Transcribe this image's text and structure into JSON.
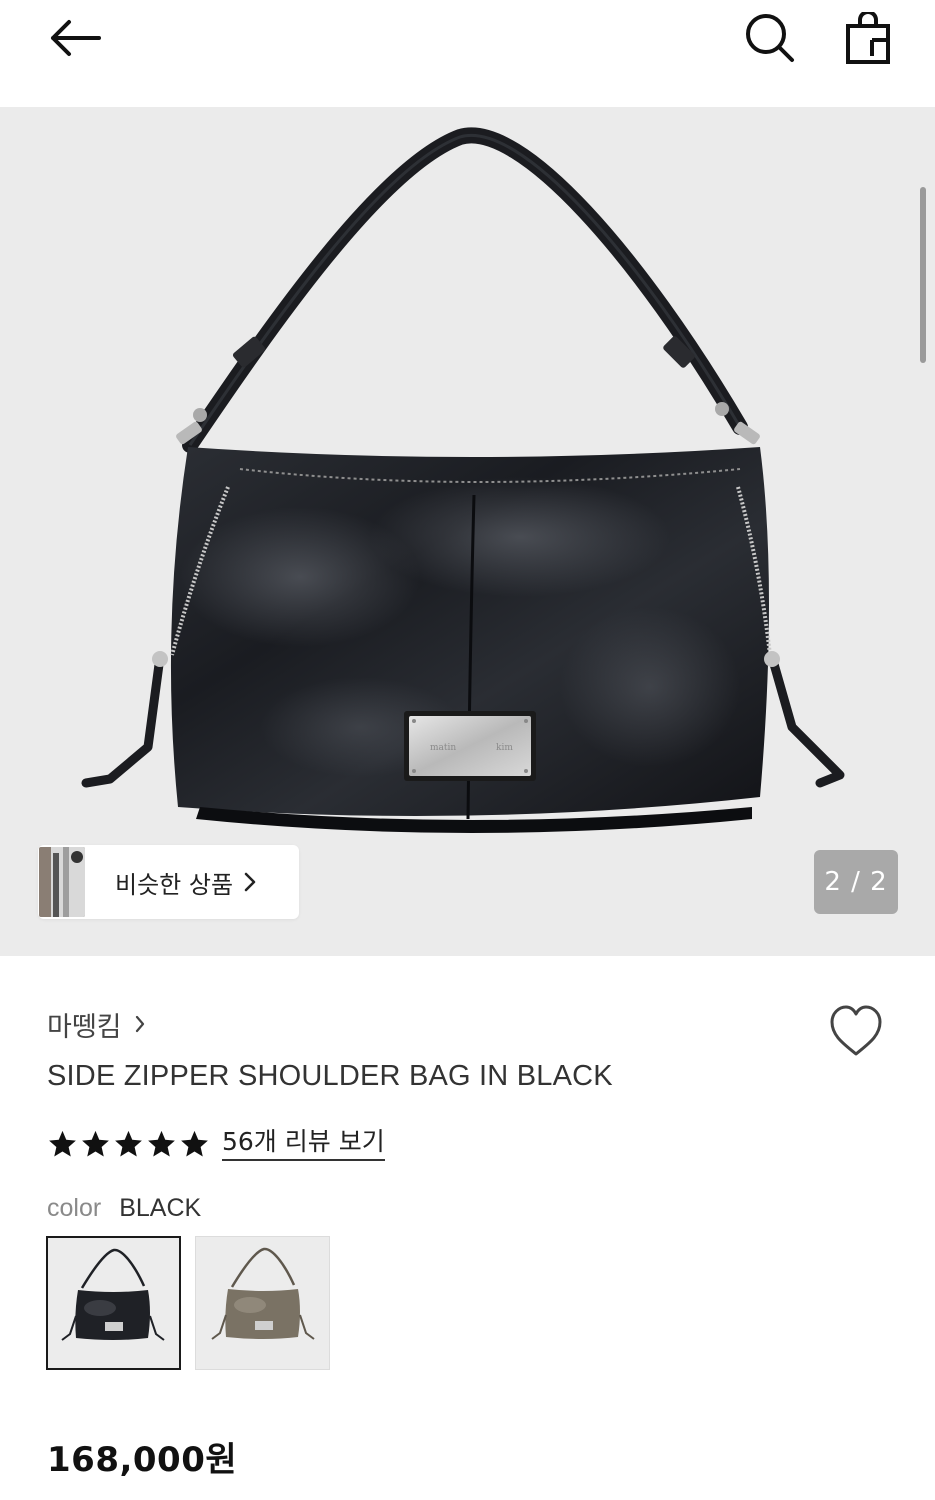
{
  "header": {
    "back_icon": "arrow-left-icon",
    "search_icon": "search-icon",
    "cart_icon": "shopping-bag-icon"
  },
  "gallery": {
    "similar_button_label": "비슷한 상품",
    "page_indicator": "2 / 2",
    "plate_text_left": "matin",
    "plate_text_right": "kim"
  },
  "product": {
    "brand": "마뗑킴",
    "name": "SIDE ZIPPER SHOULDER BAG IN BLACK",
    "rating": 5,
    "rating_max": 5,
    "review_link": "56개 리뷰 보기",
    "color_label": "color",
    "color_value": "BLACK",
    "price": "168,000원"
  },
  "swatches": [
    {
      "name": "black",
      "selected": true,
      "color": "#1f2126"
    },
    {
      "name": "khaki",
      "selected": false,
      "color": "#7a7264"
    }
  ],
  "colors": {
    "hero_bg": "#ebebeb",
    "page_indicator_bg": "#a9a9a9",
    "text_primary": "#1a1a1a"
  }
}
